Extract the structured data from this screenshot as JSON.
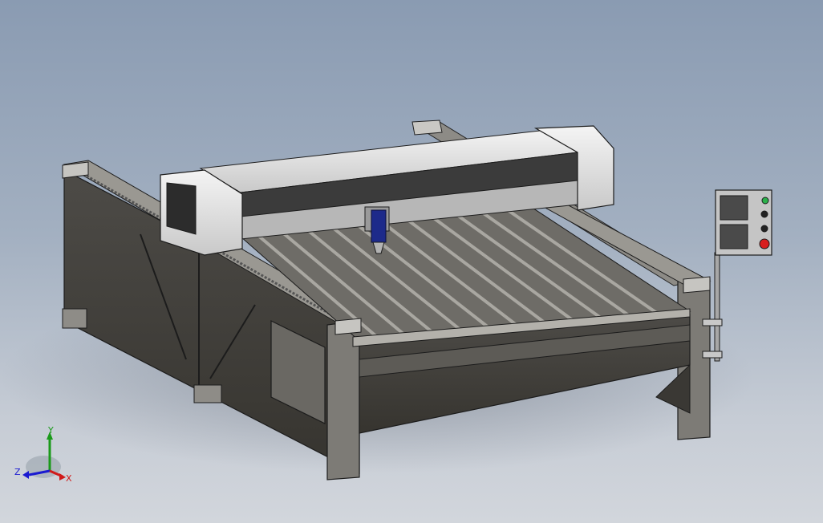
{
  "viewport": {
    "background_top": "#8a9bb2",
    "background_bottom": "#d2d6dc",
    "model_description_hidden": true
  },
  "triad": {
    "x_label": "X",
    "y_label": "Y",
    "z_label": "Z",
    "x_color": "#d11a1a",
    "y_color": "#1a9a1a",
    "z_color": "#1a1ad1"
  },
  "control_panel": {
    "indicator_colors": [
      "#2bb04a",
      "#222222",
      "#222222",
      "#d81e1e"
    ]
  }
}
